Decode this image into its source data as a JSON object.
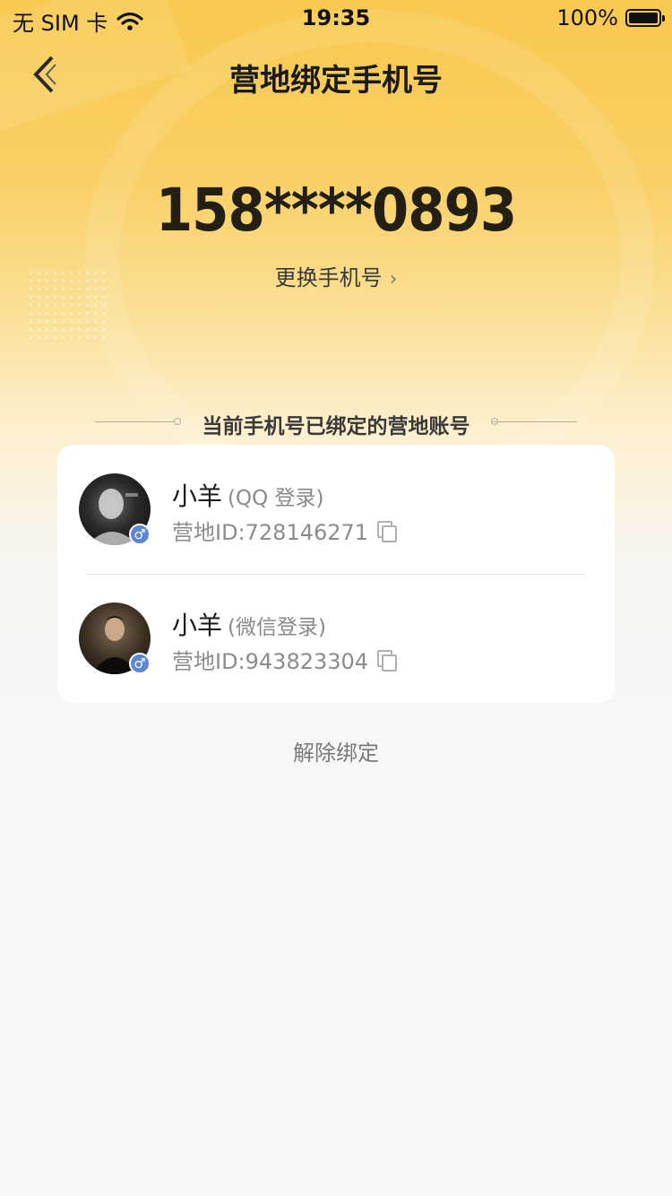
{
  "status_bar": {
    "carrier": "无 SIM 卡",
    "time": "19:35",
    "battery": "100%"
  },
  "nav": {
    "title": "营地绑定手机号"
  },
  "phone": {
    "masked_number": "158****0893",
    "change_label": "更换手机号"
  },
  "section": {
    "title": "当前手机号已绑定的营地账号"
  },
  "accounts": [
    {
      "name": "小羊",
      "login_type": "(QQ 登录)",
      "id_text": "营地ID:728146271",
      "gender": "male"
    },
    {
      "name": "小羊",
      "login_type": "(微信登录)",
      "id_text": "营地ID:943823304",
      "gender": "male"
    }
  ],
  "unbind_label": "解除绑定",
  "colors": {
    "hero_top": "#f8c94e",
    "page_bg": "#f6f7f9",
    "gender_badge": "#5b86d8"
  }
}
